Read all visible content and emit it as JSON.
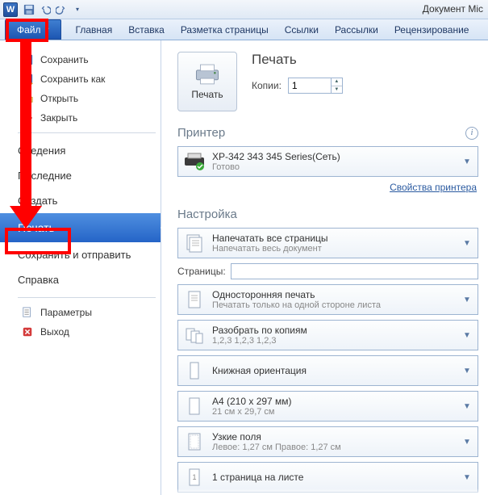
{
  "title": "Документ Mic",
  "tabs": {
    "file": "Файл",
    "home": "Главная",
    "insert": "Вставка",
    "layout": "Разметка страницы",
    "refs": "Ссылки",
    "mail": "Рассылки",
    "review": "Рецензирование"
  },
  "left": {
    "save": "Сохранить",
    "saveas": "Сохранить как",
    "open": "Открыть",
    "close": "Закрыть",
    "info": "Сведения",
    "recent": "Последние",
    "new": "Создать",
    "print": "Печать",
    "send": "Сохранить и отправить",
    "help": "Справка",
    "options": "Параметры",
    "exit": "Выход"
  },
  "print": {
    "title": "Печать",
    "button": "Печать",
    "copies_label": "Копии:",
    "copies_value": "1"
  },
  "printer": {
    "section": "Принтер",
    "name": "XP-342 343 345 Series(Сеть)",
    "status": "Готово",
    "props": "Свойства принтера"
  },
  "settings": {
    "section": "Настройка",
    "range_l1": "Напечатать все страницы",
    "range_l2": "Напечатать весь документ",
    "pages_label": "Страницы:",
    "pages_value": "",
    "sides_l1": "Односторонняя печать",
    "sides_l2": "Печатать только на одной стороне листа",
    "collate_l1": "Разобрать по копиям",
    "collate_l2": "1,2,3   1,2,3   1,2,3",
    "orient_l1": "Книжная ориентация",
    "paper_l1": "A4 (210 x 297 мм)",
    "paper_l2": "21 см x 29,7 см",
    "margins_l1": "Узкие поля",
    "margins_l2": "Левое: 1,27 см   Правое: 1,27 см",
    "sheet_l1": "1 страница на листе"
  }
}
